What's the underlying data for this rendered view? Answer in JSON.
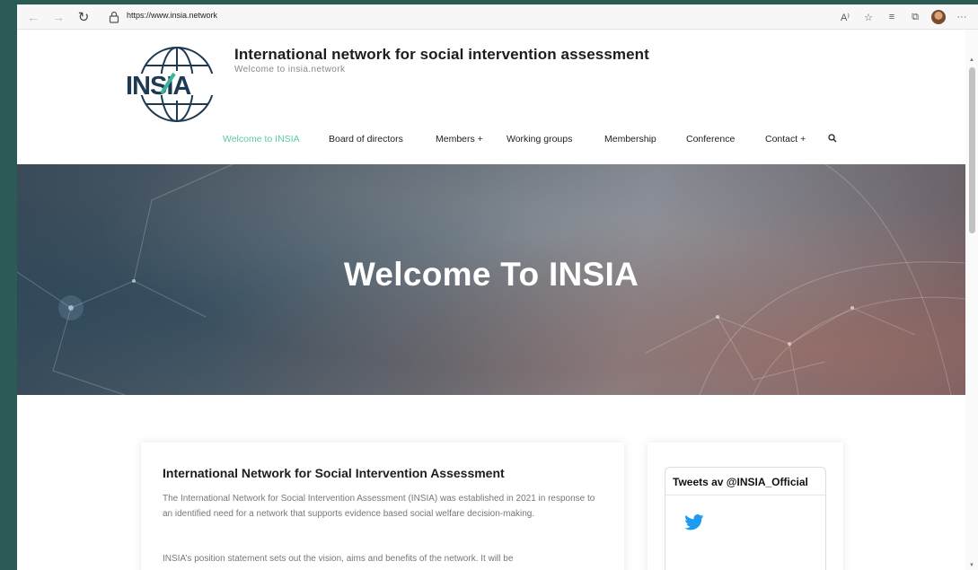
{
  "browser": {
    "url": "https://www.insia.network",
    "icons": [
      "back-arrow-icon",
      "forward-arrow-icon",
      "reload-icon",
      "lock-icon",
      "read-aloud-icon",
      "favorites-add-icon",
      "favorites-icon",
      "collections-icon",
      "profile-avatar",
      "more-icon"
    ],
    "read_aloud": "A⁾",
    "more": "···"
  },
  "site": {
    "title": "International network for social intervention assessment",
    "tagline": "Welcome to insia.network",
    "logo_text": "INSIA"
  },
  "menu": [
    {
      "label": "Welcome to INSIA",
      "active": true
    },
    {
      "label": "Board of directors"
    },
    {
      "label": "Members +"
    },
    {
      "label": "Working groups"
    },
    {
      "label": "Membership"
    },
    {
      "label": "Conference"
    },
    {
      "label": "Contact +"
    }
  ],
  "hero": {
    "title": "Welcome To INSIA"
  },
  "main": {
    "heading": "International Network for Social Intervention Assessment",
    "paragraph1": "The International Network for Social Intervention Assessment (INSIA) was established in 2021 in response to an identified need for a network that supports evidence based social welfare decision-making.",
    "paragraph2": "INSIA’s position statement sets out the vision, aims and benefits of the network. It will be"
  },
  "sidebar": {
    "tweets_heading": "Tweets av @INSIA_Official"
  },
  "colors": {
    "accent": "#5cc7a6",
    "logo_navy": "#1e3a52",
    "logo_teal": "#3bb39b",
    "twitter_blue": "#1d9bf0"
  }
}
